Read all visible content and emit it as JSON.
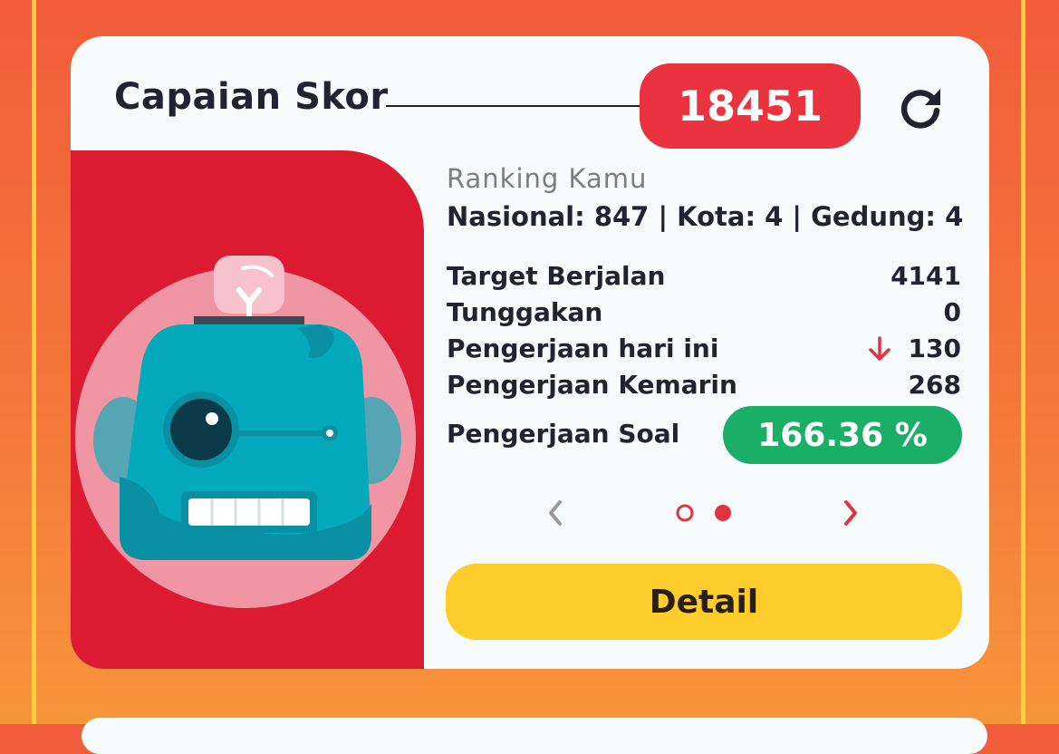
{
  "score_card": {
    "title": "Capaian Skor",
    "score": "18451",
    "refresh_icon": "refresh-icon",
    "ranking": {
      "label": "Ranking Kamu",
      "values": "Nasional: 847 | Kota: 4 | Gedung: 4"
    },
    "stats": [
      {
        "label": "Target Berjalan",
        "value": "4141"
      },
      {
        "label": "Tunggakan",
        "value": "0"
      },
      {
        "label": "Pengerjaan hari ini",
        "value": "130",
        "trend_icon": "arrow-down-icon"
      },
      {
        "label": "Pengerjaan Kemarin",
        "value": "268"
      }
    ],
    "completion": {
      "label": "Pengerjaan Soal",
      "value": "166.36 %"
    },
    "pager": {
      "prev_icon": "chevron-left-icon",
      "next_icon": "chevron-right-icon",
      "total": 2,
      "active": 2
    },
    "detail_label": "Detail",
    "avatar": "robot-avatar"
  },
  "colors": {
    "background": "#f25c3b",
    "score_pill": "#eb3340",
    "avatar_panel": "#dc1b32",
    "completion_pill": "#1aae66",
    "detail_button": "#ffcd2b",
    "edge_accent": "#ffd23a"
  }
}
